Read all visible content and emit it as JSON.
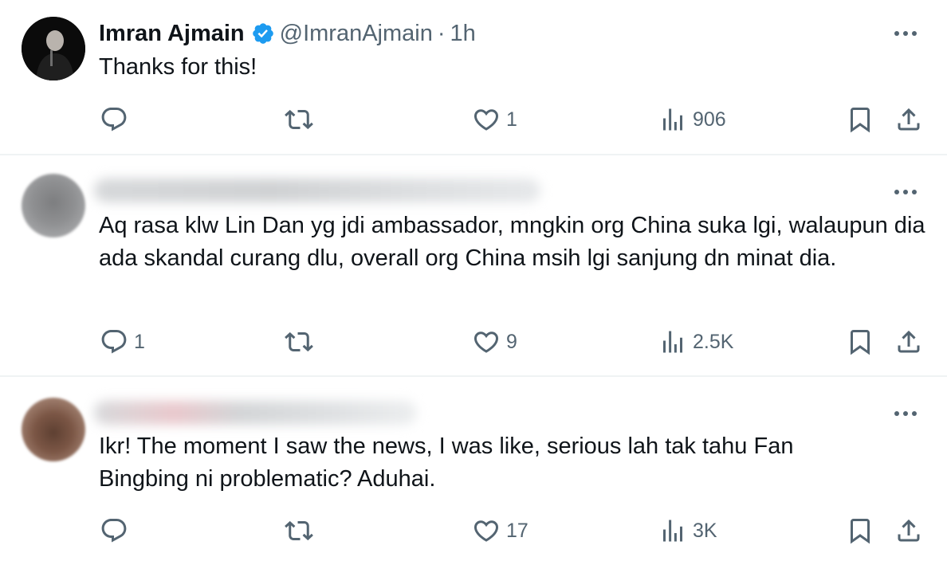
{
  "tweets": [
    {
      "display_name": "Imran Ajmain",
      "verified": true,
      "handle": "@ImranAjmain",
      "separator": "·",
      "time": "1h",
      "text": "Thanks for this!",
      "avatar": "speaker-photo-avatar",
      "replies": "",
      "reposts": "",
      "likes": "1",
      "views": "906"
    },
    {
      "display_name_redacted": true,
      "text": "Aq rasa klw Lin Dan yg jdi ambassador, mngkin org China suka lgi, walaupun dia ada skandal curang dlu, overall org China msih lgi sanjung dn minat dia.",
      "avatar": "blurred-avatar",
      "replies": "1",
      "reposts": "",
      "likes": "9",
      "views": "2.5K"
    },
    {
      "display_name_redacted": true,
      "text": "Ikr! The moment I saw the news, I was like, serious lah tak tahu Fan Bingbing ni problematic? Aduhai.",
      "avatar": "blurred-avatar",
      "replies": "",
      "reposts": "",
      "likes": "17",
      "views": "3K"
    }
  ],
  "colors": {
    "text_primary": "#0f1419",
    "text_secondary": "#536471",
    "verified_blue": "#1d9bf0",
    "divider": "#eff3f4"
  },
  "icons": [
    "reply-icon",
    "repost-icon",
    "like-icon",
    "views-icon",
    "bookmark-icon",
    "share-icon",
    "more-icon",
    "verified-badge-icon"
  ]
}
